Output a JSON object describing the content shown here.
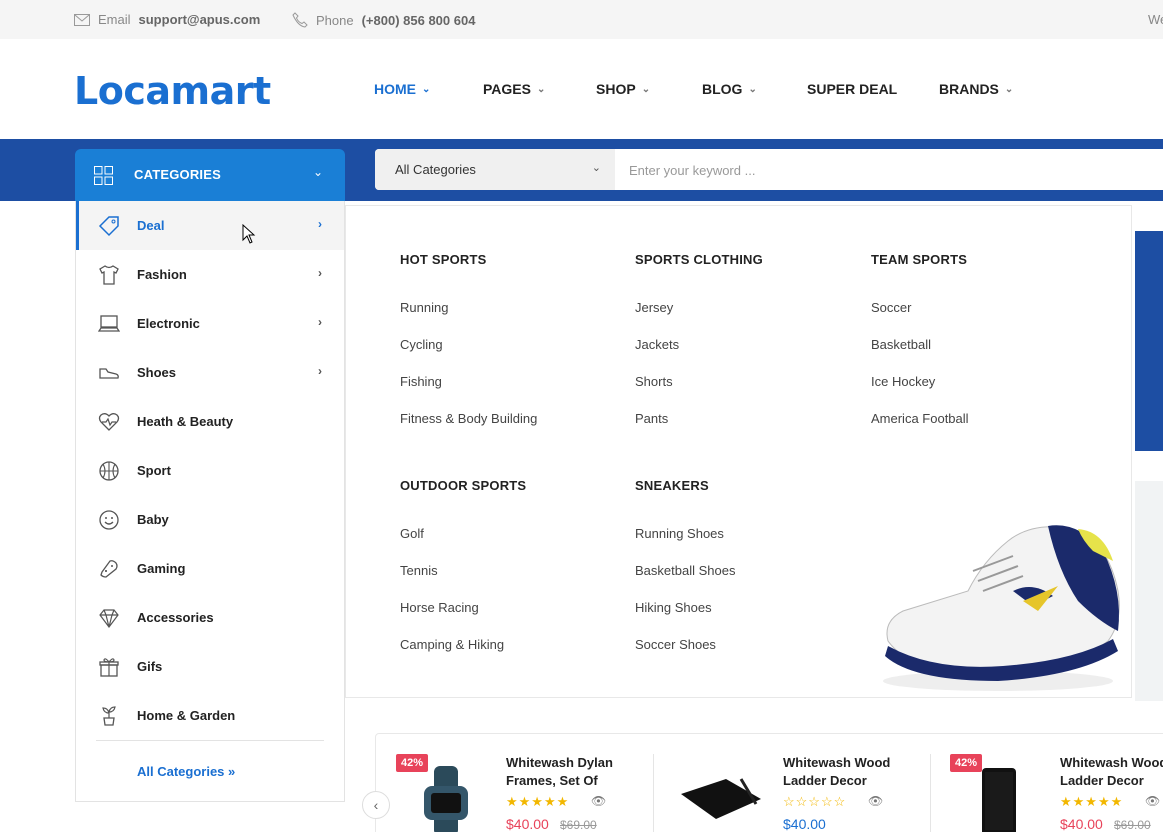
{
  "topbar": {
    "email_label": "Email",
    "email": "support@apus.com",
    "phone_label": "Phone",
    "phone": "(+800) 856 800 604",
    "welcome_partial": "We"
  },
  "header": {
    "logo": "Locamart",
    "nav": [
      {
        "label": "HOME",
        "active": true,
        "dropdown": true
      },
      {
        "label": "PAGES",
        "dropdown": true
      },
      {
        "label": "SHOP",
        "dropdown": true
      },
      {
        "label": "BLOG",
        "dropdown": true
      },
      {
        "label": "SUPER DEAL",
        "dropdown": false
      },
      {
        "label": "BRANDS",
        "dropdown": true
      }
    ]
  },
  "categories_button": {
    "label": "CATEGORIES"
  },
  "search": {
    "category_value": "All Categories",
    "placeholder": "Enter your keyword ..."
  },
  "sidebar": {
    "items": [
      {
        "label": "Deal",
        "icon": "tag-icon",
        "submenu": true,
        "active": true
      },
      {
        "label": "Fashion",
        "icon": "tshirt-icon",
        "submenu": true
      },
      {
        "label": "Electronic",
        "icon": "laptop-icon",
        "submenu": true
      },
      {
        "label": "Shoes",
        "icon": "shoe-icon",
        "submenu": true
      },
      {
        "label": "Heath & Beauty",
        "icon": "heart-pulse-icon",
        "submenu": false
      },
      {
        "label": "Sport",
        "icon": "basketball-icon",
        "submenu": false
      },
      {
        "label": "Baby",
        "icon": "smiley-icon",
        "submenu": false
      },
      {
        "label": "Gaming",
        "icon": "gamepad-icon",
        "submenu": false
      },
      {
        "label": "Accessories",
        "icon": "diamond-icon",
        "submenu": false
      },
      {
        "label": "Gifs",
        "icon": "gift-icon",
        "submenu": false
      },
      {
        "label": "Home & Garden",
        "icon": "plant-icon",
        "submenu": false
      }
    ],
    "all_categories": "All Categories »"
  },
  "mega": {
    "columns": [
      {
        "heading": "HOT SPORTS",
        "links": [
          "Running",
          "Cycling",
          "Fishing",
          "Fitness & Body Building"
        ]
      },
      {
        "heading": "SPORTS CLOTHING",
        "links": [
          "Jersey",
          "Jackets",
          "Shorts",
          "Pants"
        ]
      },
      {
        "heading": "TEAM SPORTS",
        "links": [
          "Soccer",
          "Basketball",
          "Ice Hockey",
          "America Football"
        ]
      },
      {
        "heading": "OUTDOOR SPORTS",
        "links": [
          "Golf",
          "Tennis",
          "Horse Racing",
          "Camping & Hiking"
        ]
      },
      {
        "heading": "SNEAKERS",
        "links": [
          "Running Shoes",
          "Basketball Shoes",
          "Hiking Shoes",
          "Soccer Shoes"
        ]
      }
    ]
  },
  "products": [
    {
      "badge": "42%",
      "name": "Whitewash Dylan Frames, Set Of",
      "rating": 5,
      "price": "$40.00",
      "old_price": "$69.00"
    },
    {
      "badge": "",
      "name": "Whitewash Wood Ladder Decor",
      "rating": 0,
      "price": "$40.00",
      "old_price": ""
    },
    {
      "badge": "42%",
      "name": "Whitewash Wood Ladder Decor",
      "rating": 5,
      "price": "$40.00",
      "old_price": "$69.00"
    }
  ],
  "colors": {
    "accent": "#1a6fd1",
    "band": "#1d4ea3",
    "category_button": "#1a7fd6",
    "sale": "#e8435a",
    "star": "#f2b700"
  }
}
